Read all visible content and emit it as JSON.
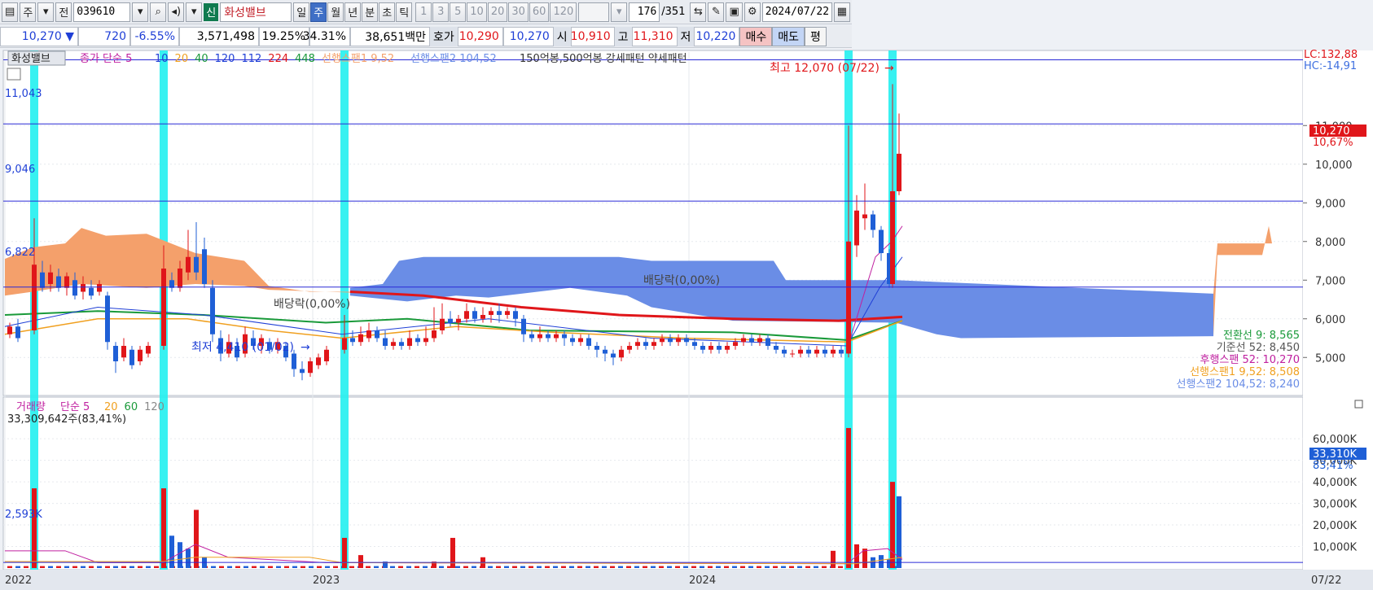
{
  "toolbar": {
    "view_label": "주",
    "prev_label": "전",
    "code": "039610",
    "market_tag": "신",
    "stock_name": "화성밸브",
    "periods": [
      "일",
      "주",
      "월",
      "년",
      "분",
      "초",
      "틱"
    ],
    "active_period": "주",
    "intervals": [
      "1",
      "3",
      "5",
      "10",
      "20",
      "30",
      "60",
      "120"
    ],
    "count": "176",
    "total": "/351",
    "date": "2024/07/22"
  },
  "quote": {
    "price": "10,270 ▼",
    "change": "720",
    "change_pct": "-6.55%",
    "volume": "3,571,498",
    "pct1": "19.25%",
    "pct2": "34.31%",
    "amount": "38,651백만",
    "ask_label": "호가",
    "ask1": "10,290",
    "ask2": "10,270",
    "open_label": "시",
    "open": "10,910",
    "high_label": "고",
    "high": "11,310",
    "low_label": "저",
    "low": "10,220",
    "buy_label": "매수",
    "sell_label": "매도",
    "eval_label": "평"
  },
  "legend": {
    "stock": "화성밸브",
    "ma_label": "종가 단순 5",
    "ma_periods": [
      "10",
      "20",
      "40",
      "120",
      "112",
      "224",
      "448"
    ],
    "span1": "선행스팬1 9,52",
    "span2": "선행스팬2 104,52",
    "pattern": "150억봉,500억봉 강세패턴 약세패턴",
    "vol_label": "거래량",
    "vol_ma_label": "단순 5",
    "vol_ma_periods": [
      "20",
      "60",
      "120"
    ],
    "vol_info": "33,309,642주(83,41%)"
  },
  "annotations": {
    "lc": "LC:132,88",
    "hc": "HC:-14,91",
    "high_mark": "최고 12,070 (07/22)",
    "low_mark": "최저 4,410 (01/02)",
    "dividend1": "배당락(0,00%)",
    "dividend2": "배당락(0,00%)",
    "level1": "11,043",
    "level2": "9,046",
    "level3": "6,822",
    "vol_level": "2,593K",
    "price_tag": "10,270",
    "price_pct": "10,67%",
    "vol_tag": "33,310K",
    "vol_pct": "83,41%",
    "ichimoku": [
      "전환선 9: 8,565",
      "기준선 52: 8,450",
      "후행스팬 52: 10,270",
      "선행스팬1 9,52: 8,508",
      "선행스팬2 104,52: 8,240"
    ],
    "date_end": "07/22"
  },
  "colors": {
    "up": "#e0161a",
    "down": "#1f5fd6",
    "cyan_band": "#22f0f0",
    "cloud_orange": "#f4a06b",
    "cloud_blue": "#6a8de6"
  },
  "chart_data": {
    "type": "candlestick",
    "price_axis": [
      "11,000",
      "10,000",
      "9,000",
      "8,000",
      "7,000",
      "6,000",
      "5,000"
    ],
    "price_ticks": [
      11000,
      10000,
      9000,
      8000,
      7000,
      6000,
      5000
    ],
    "price_range": [
      4100,
      12900
    ],
    "volume_axis": [
      "60,000K",
      "50,000K",
      "40,000K",
      "30,000K",
      "20,000K",
      "10,000K"
    ],
    "volume_ticks": [
      60000,
      50000,
      40000,
      30000,
      20000,
      10000
    ],
    "volume_range": [
      0,
      68000
    ],
    "x_labels": [
      "2022",
      "2023",
      "2024"
    ],
    "price_levels": [
      11043,
      9046,
      6822
    ],
    "volume_level": 2593,
    "current_price": 10270,
    "current_volume": 33310
  }
}
